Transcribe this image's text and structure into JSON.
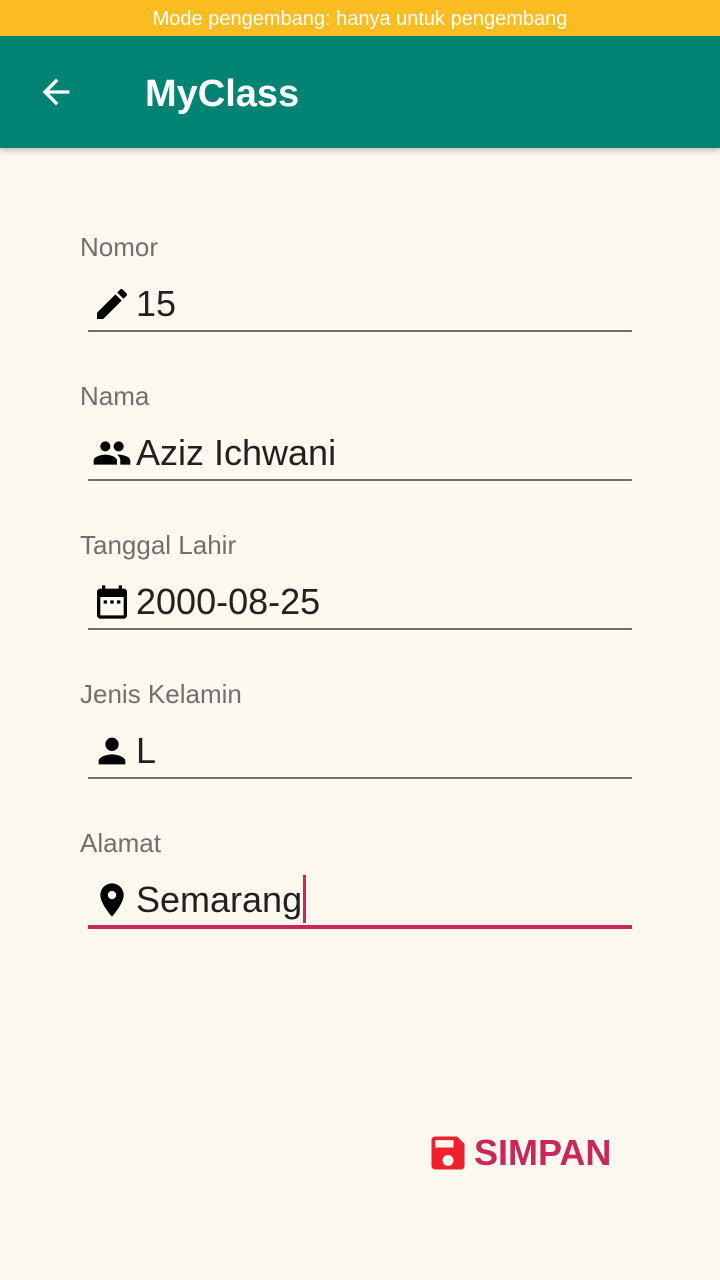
{
  "status_bar": {
    "banner_text": "Mode pengembang: hanya untuk pengembang"
  },
  "appbar": {
    "title": "MyClass",
    "back_icon": "arrow-back-icon"
  },
  "form": {
    "fields": [
      {
        "label": "Nomor",
        "value": "15",
        "icon": "pencil-icon"
      },
      {
        "label": "Nama",
        "value": "Aziz Ichwani",
        "icon": "people-icon"
      },
      {
        "label": "Tanggal Lahir",
        "value": "2000-08-25",
        "icon": "calendar-icon"
      },
      {
        "label": "Jenis Kelamin",
        "value": "L",
        "icon": "person-icon"
      },
      {
        "label": "Alamat",
        "value": "Semarang",
        "icon": "location-pin-icon",
        "focused": true
      }
    ]
  },
  "save_button": {
    "label": "SIMPAN",
    "icon": "floppy-disk-icon"
  },
  "colors": {
    "banner": "#fbbd22",
    "appbar": "#018374",
    "background": "#fdf9ee",
    "accent": "#c8265c",
    "save_icon": "#f21f2f"
  }
}
